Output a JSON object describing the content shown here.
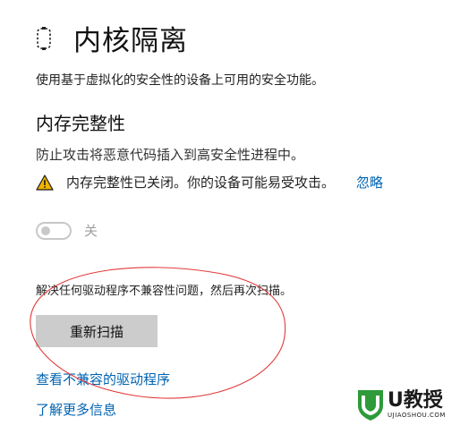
{
  "header": {
    "title": "内核隔离",
    "icon": "core-isolation-icon"
  },
  "subtitle": "使用基于虚拟化的安全性的设备上可用的安全功能。",
  "memory_integrity": {
    "title": "内存完整性",
    "description": "防止攻击将恶意代码插入到高安全性进程中。",
    "warning_text": "内存完整性已关闭。你的设备可能易受攻击。",
    "warning_icon": "warning-triangle-icon",
    "ignore_label": "忽略",
    "toggle_state": "off",
    "toggle_label": "关"
  },
  "rescan": {
    "description": "解决任何驱动程序不兼容性问题，然后再次扫描。",
    "button_label": "重新扫描"
  },
  "links": {
    "view_incompatible": "查看不兼容的驱动程序",
    "learn_more": "了解更多信息"
  },
  "watermark": {
    "brand": "U教授",
    "url": "UJIAOSHOU.COM"
  },
  "colors": {
    "link": "#0063b1",
    "warning": "#f0b400",
    "annotation": "#e23b3b",
    "watermark_green": "#2e9a3a",
    "button_bg": "#cccccc"
  }
}
